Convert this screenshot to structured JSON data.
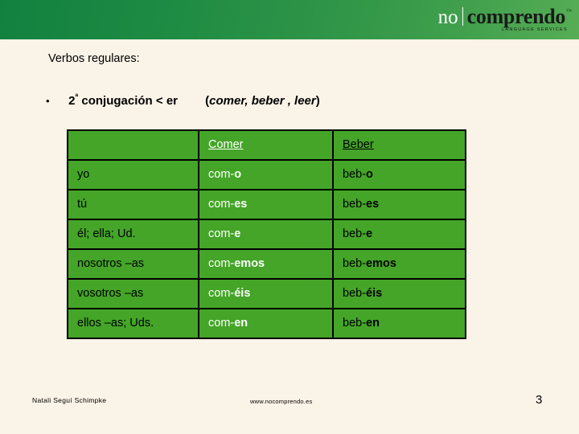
{
  "header": {
    "logo": {
      "word_one": "no",
      "word_two": "comprendo",
      "trademark": "™",
      "tagline": "LANGUAGE SERVICES"
    },
    "banner_color_left": "#128140",
    "banner_color_right": "#56ad55"
  },
  "slide": {
    "intro": "Verbos regulares:",
    "bullet": {
      "marker": "•",
      "ordinal_number": "2",
      "ordinal_suffix": "ª",
      "text": " conjugación < er",
      "examples_open": "(",
      "examples": "comer, beber , leer",
      "examples_close": ")"
    }
  },
  "table": {
    "accent_color": "#44a528",
    "border_color": "#000000",
    "columns": [
      {
        "key": "pronoun",
        "label": ""
      },
      {
        "key": "comer",
        "label": "Comer"
      },
      {
        "key": "beber",
        "label": "Beber"
      }
    ],
    "rows": [
      {
        "pronoun": "yo",
        "comer_stem": "com-",
        "comer_ending": "o",
        "beber_stem": "beb-",
        "beber_ending": "o"
      },
      {
        "pronoun": "tú",
        "comer_stem": "com-",
        "comer_ending": "es",
        "beber_stem": "beb-",
        "beber_ending": "es"
      },
      {
        "pronoun": "él; ella; Ud.",
        "comer_stem": "com-",
        "comer_ending": "e",
        "beber_stem": "beb-",
        "beber_ending": "e"
      },
      {
        "pronoun": "nosotros –as",
        "comer_stem": "com-",
        "comer_ending": "emos",
        "beber_stem": "beb-",
        "beber_ending": "emos"
      },
      {
        "pronoun": "vosotros –as",
        "comer_stem": "com-",
        "comer_ending": "éis",
        "beber_stem": "beb-",
        "beber_ending": "éis"
      },
      {
        "pronoun": "ellos –as; Uds.",
        "comer_stem": "com-",
        "comer_ending": "en",
        "beber_stem": "beb-",
        "beber_ending": "en"
      }
    ]
  },
  "footer": {
    "author": "Natali Seguí Schimpke",
    "url": "www.nocomprendo.es",
    "page_number": "3"
  }
}
